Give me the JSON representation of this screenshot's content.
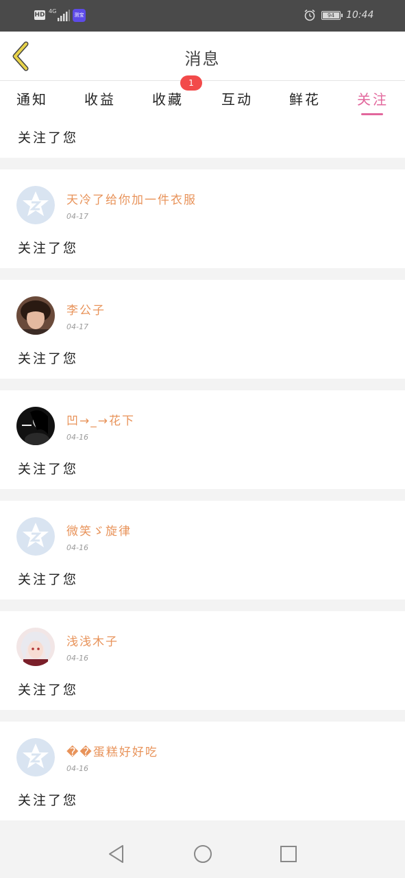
{
  "status_bar": {
    "hd": "HD",
    "network": "4G",
    "app_badge": "测宝",
    "battery": "94",
    "time": "10:44"
  },
  "header": {
    "title": "消息"
  },
  "tabs": [
    {
      "label": "通知"
    },
    {
      "label": "收益"
    },
    {
      "label": "收藏",
      "badge": "1"
    },
    {
      "label": "互动"
    },
    {
      "label": "鲜花"
    },
    {
      "label": "关注"
    }
  ],
  "active_tab": "关注",
  "feed": {
    "partial_item": {
      "text": "关注了您"
    },
    "items": [
      {
        "name": "天冷了给你加一件衣服",
        "date": "04-17",
        "text": "关注了您",
        "avatar": "default-avatar-icon"
      },
      {
        "name": "李公子",
        "date": "04-17",
        "text": "关注了您",
        "avatar": "photo-man"
      },
      {
        "name": "凹→_→花下",
        "date": "04-16",
        "text": "关注了您",
        "avatar": "photo-woman-dark"
      },
      {
        "name": "微笑ゞ旋律",
        "date": "04-16",
        "text": "关注了您",
        "avatar": "default-avatar-icon"
      },
      {
        "name": "浅浅木子",
        "date": "04-16",
        "text": "关注了您",
        "avatar": "photo-anime"
      },
      {
        "name": "��蛋糕好好吃",
        "date": "04-16",
        "text": "关注了您",
        "avatar": "default-avatar-icon"
      }
    ]
  },
  "colors": {
    "accent": "#e2679c",
    "name_color": "#e8935a",
    "badge": "#f24a4a",
    "back_icon": "#e8d34a"
  }
}
